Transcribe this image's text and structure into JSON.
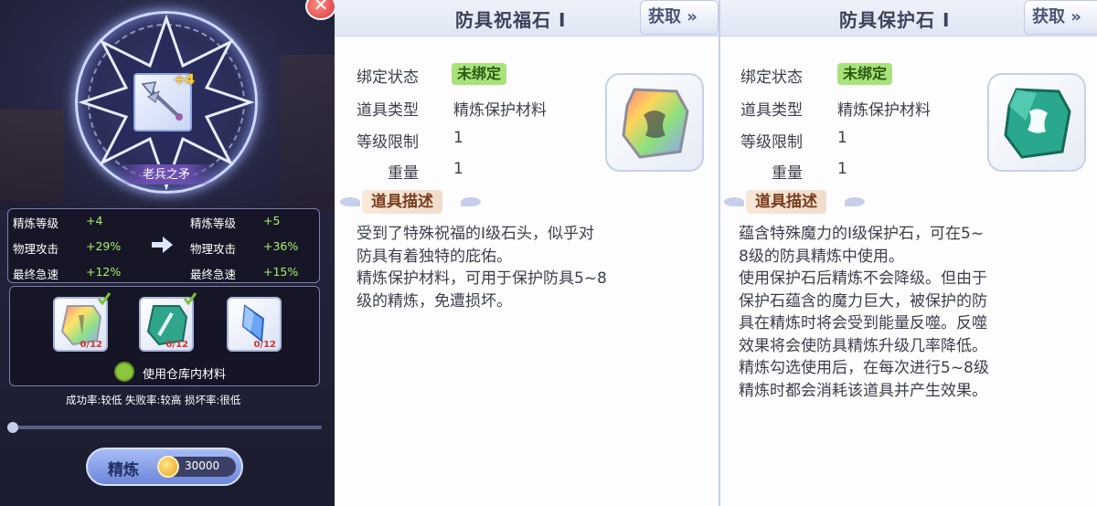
{
  "refine": {
    "weapon": {
      "name": "老兵之矛",
      "level_badge": "+4"
    },
    "stats": {
      "current": [
        {
          "label": "精炼等级",
          "value": "+4"
        },
        {
          "label": "物理攻击",
          "value": "+29%"
        },
        {
          "label": "最终急速",
          "value": "+12%"
        }
      ],
      "next": [
        {
          "label": "精炼等级",
          "value": "+5"
        },
        {
          "label": "物理攻击",
          "value": "+36%"
        },
        {
          "label": "最终急速",
          "value": "+15%"
        }
      ]
    },
    "materials": [
      {
        "icon": "blessing-stone-icon",
        "qty": "0/12",
        "checked": true
      },
      {
        "icon": "protection-stone-icon",
        "qty": "0/12",
        "checked": true
      },
      {
        "icon": "crystal-icon",
        "qty": "0/12",
        "checked": false
      }
    ],
    "use_warehouse_label": "使用仓库内材料",
    "rates": "成功率:较低 失败率:较高 损坏率:很低",
    "refine_button": "精炼",
    "cost": "30000"
  },
  "items": [
    {
      "title": "防具祝福石 Ⅰ",
      "get_button": "获取",
      "get_icon": "double-chevron-icon",
      "fields": [
        {
          "label": "绑定状态",
          "value": "未绑定",
          "badge": true
        },
        {
          "label": "道具类型",
          "value": "精炼保护材料"
        },
        {
          "label": "等级限制",
          "value": "1"
        },
        {
          "label": "重量",
          "value": "1"
        }
      ],
      "desc_title": "道具描述",
      "desc_lines": [
        "受到了特殊祝福的Ⅰ级石头，似乎对",
        "防具有着独特的庇佑。",
        "精炼保护材料，可用于保护防具5~8",
        "级的精炼，免遭损坏。"
      ]
    },
    {
      "title": "防具保护石 Ⅰ",
      "get_button": "获取",
      "get_icon": "double-chevron-icon",
      "fields": [
        {
          "label": "绑定状态",
          "value": "未绑定",
          "badge": true
        },
        {
          "label": "道具类型",
          "value": "精炼保护材料"
        },
        {
          "label": "等级限制",
          "value": "1"
        },
        {
          "label": "重量",
          "value": "1"
        }
      ],
      "desc_title": "道具描述",
      "desc_lines": [
        "蕴含特殊魔力的Ⅰ级保护石，可在5~",
        "8级的防具精炼中使用。",
        "使用保护石后精炼不会降级。但由于",
        "保护石蕴含的魔力巨大，被保护的防",
        "具在精炼时将会受到能量反噬。反噬",
        "效果将会使防具精炼升级几率降低。",
        "精炼勾选使用后，在每次进行5~8级",
        "精炼时都会消耗该道具并产生效果。"
      ]
    }
  ],
  "colors": {
    "badge_green": "#a9e27a",
    "stat_green": "#a8f06a",
    "desc_head_bg": "#f2dccb"
  }
}
